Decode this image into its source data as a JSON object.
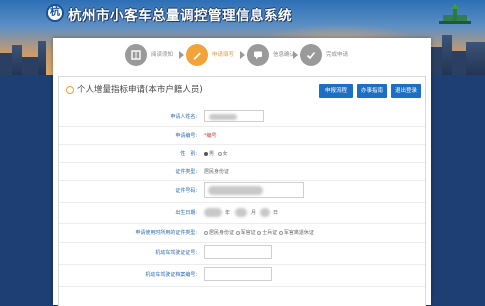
{
  "header": {
    "logo_text": "杭",
    "title": "杭州市小客车总量调控管理信息系统"
  },
  "steps": [
    {
      "label": "阅读须知",
      "active": false,
      "icon": "book-icon"
    },
    {
      "label": "申请填写",
      "active": true,
      "icon": "pencil-icon"
    },
    {
      "label": "信息确认",
      "active": false,
      "icon": "chat-icon"
    },
    {
      "label": "完成申请",
      "active": false,
      "icon": "check-icon"
    }
  ],
  "form": {
    "title": "个人增量指标申请(本市户籍人员)",
    "buttons": {
      "process": "申报流程",
      "guide": "办事指南",
      "logout": "退出登录"
    },
    "fields": {
      "name_label": "申请人姓名:",
      "number_label": "申请编号:",
      "number_value": "*编号",
      "gender_label": "性　别:",
      "gender_male": "男",
      "gender_female": "女",
      "id_type_label": "证件类型:",
      "id_type_value": "居民身份证",
      "id_number_label": "证件号码:",
      "birth_label": "出生日期:",
      "birth_year": "年",
      "birth_month": "月",
      "birth_day": "日",
      "license_type_label": "申请使用时所用的证件类型:",
      "license_opt1": "居民身份证",
      "license_opt2": "军官证",
      "license_opt3": "士兵证",
      "license_opt4": "军官离退休证",
      "license_no_label": "机动车驾驶证证号:",
      "license_file_label": "机动车驾驶证档案编号:"
    }
  },
  "colors": {
    "accent_blue": "#1c6fc4",
    "active_step": "#f2a33a",
    "label_blue": "#2e6bb0"
  }
}
